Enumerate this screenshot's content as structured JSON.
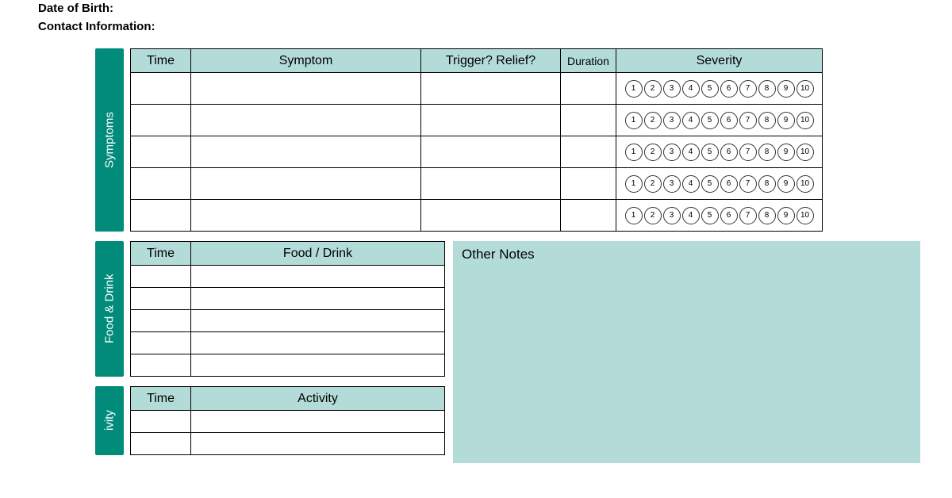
{
  "meta": {
    "dob_label": "Date of Birth:",
    "contact_label": "Contact Information:"
  },
  "sections": {
    "symptoms_tab": "Symptoms",
    "food_tab": "Food & Drink",
    "activity_tab": "ivity"
  },
  "symptoms_table": {
    "headers": {
      "time": "Time",
      "symptom": "Symptom",
      "trigger": "Trigger? Relief?",
      "duration": "Duration",
      "severity": "Severity"
    },
    "severity_scale": [
      "1",
      "2",
      "3",
      "4",
      "5",
      "6",
      "7",
      "8",
      "9",
      "10"
    ],
    "row_count": 5
  },
  "food_table": {
    "headers": {
      "time": "Time",
      "food": "Food / Drink"
    },
    "row_count": 5
  },
  "activity_table": {
    "headers": {
      "time": "Time",
      "activity": "Activity"
    },
    "row_count": 2
  },
  "notes": {
    "label": "Other Notes"
  }
}
